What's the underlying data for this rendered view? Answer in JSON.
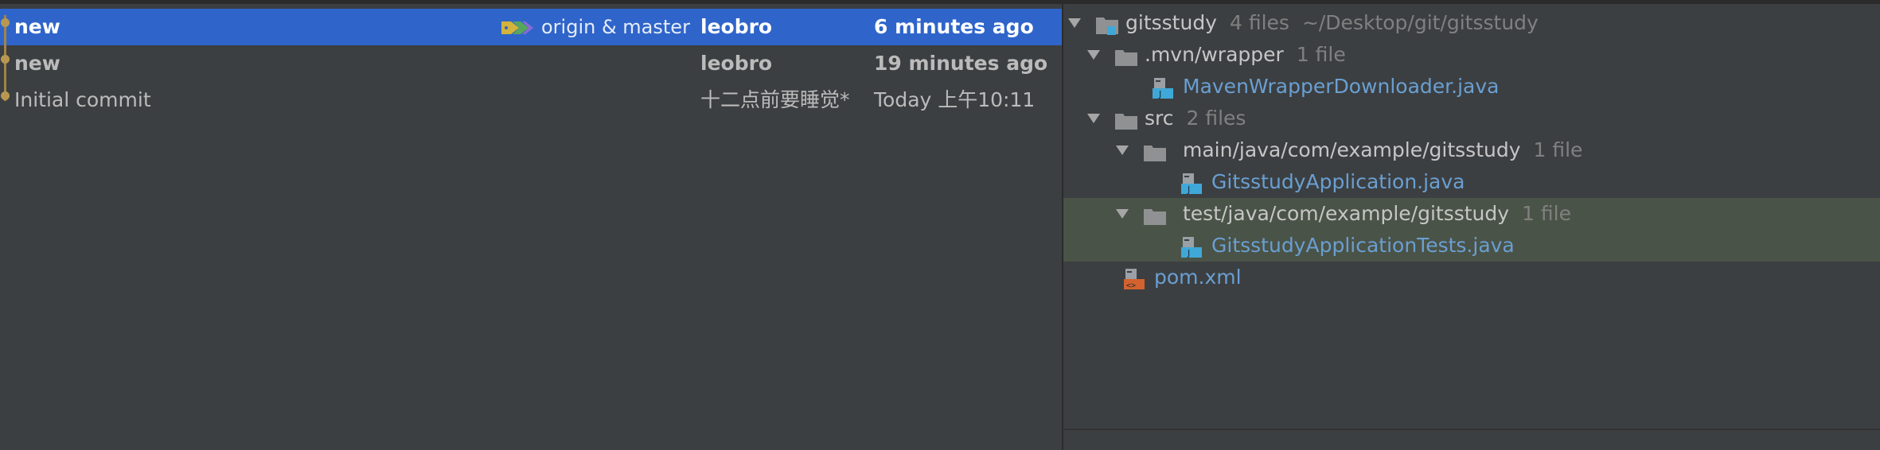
{
  "commit_log": {
    "commits": [
      {
        "subject": "new",
        "refs": "origin & master",
        "author": "leobro",
        "date": "6 minutes ago",
        "selected": true
      },
      {
        "subject": "new",
        "author": "leobro",
        "date": "19 minutes ago",
        "selected": false
      },
      {
        "subject": "Initial commit",
        "author": "十二点前要睡觉*",
        "date": "Today 上午10:11",
        "selected": false
      }
    ]
  },
  "changes_tree": {
    "root": {
      "name": "gitsstudy",
      "count": "4 files",
      "path": "~/Desktop/git/gitsstudy"
    },
    "mvn_wrapper": {
      "name": ".mvn/wrapper",
      "count": "1 file"
    },
    "maven_downloader": {
      "name": "MavenWrapperDownloader.java"
    },
    "src": {
      "name": "src",
      "count": "2 files"
    },
    "main_pkg": {
      "name": "main/java/com/example/gitsstudy",
      "count": "1 file"
    },
    "app_java": {
      "name": "GitsstudyApplication.java"
    },
    "test_pkg": {
      "name": "test/java/com/example/gitsstudy",
      "count": "1 file"
    },
    "app_tests_java": {
      "name": "GitsstudyApplicationTests.java"
    },
    "pom": {
      "name": "pom.xml"
    }
  },
  "colors": {
    "selection": "#2f65ca",
    "highlight_row": "#4a5347",
    "java_file": "#6a9fd2",
    "graph": "#a08448"
  },
  "icons": {
    "ref_tag": "tag-icon",
    "folder": "folder-icon",
    "module": "module-icon",
    "java": "java-file-icon",
    "xml": "xml-file-icon"
  }
}
